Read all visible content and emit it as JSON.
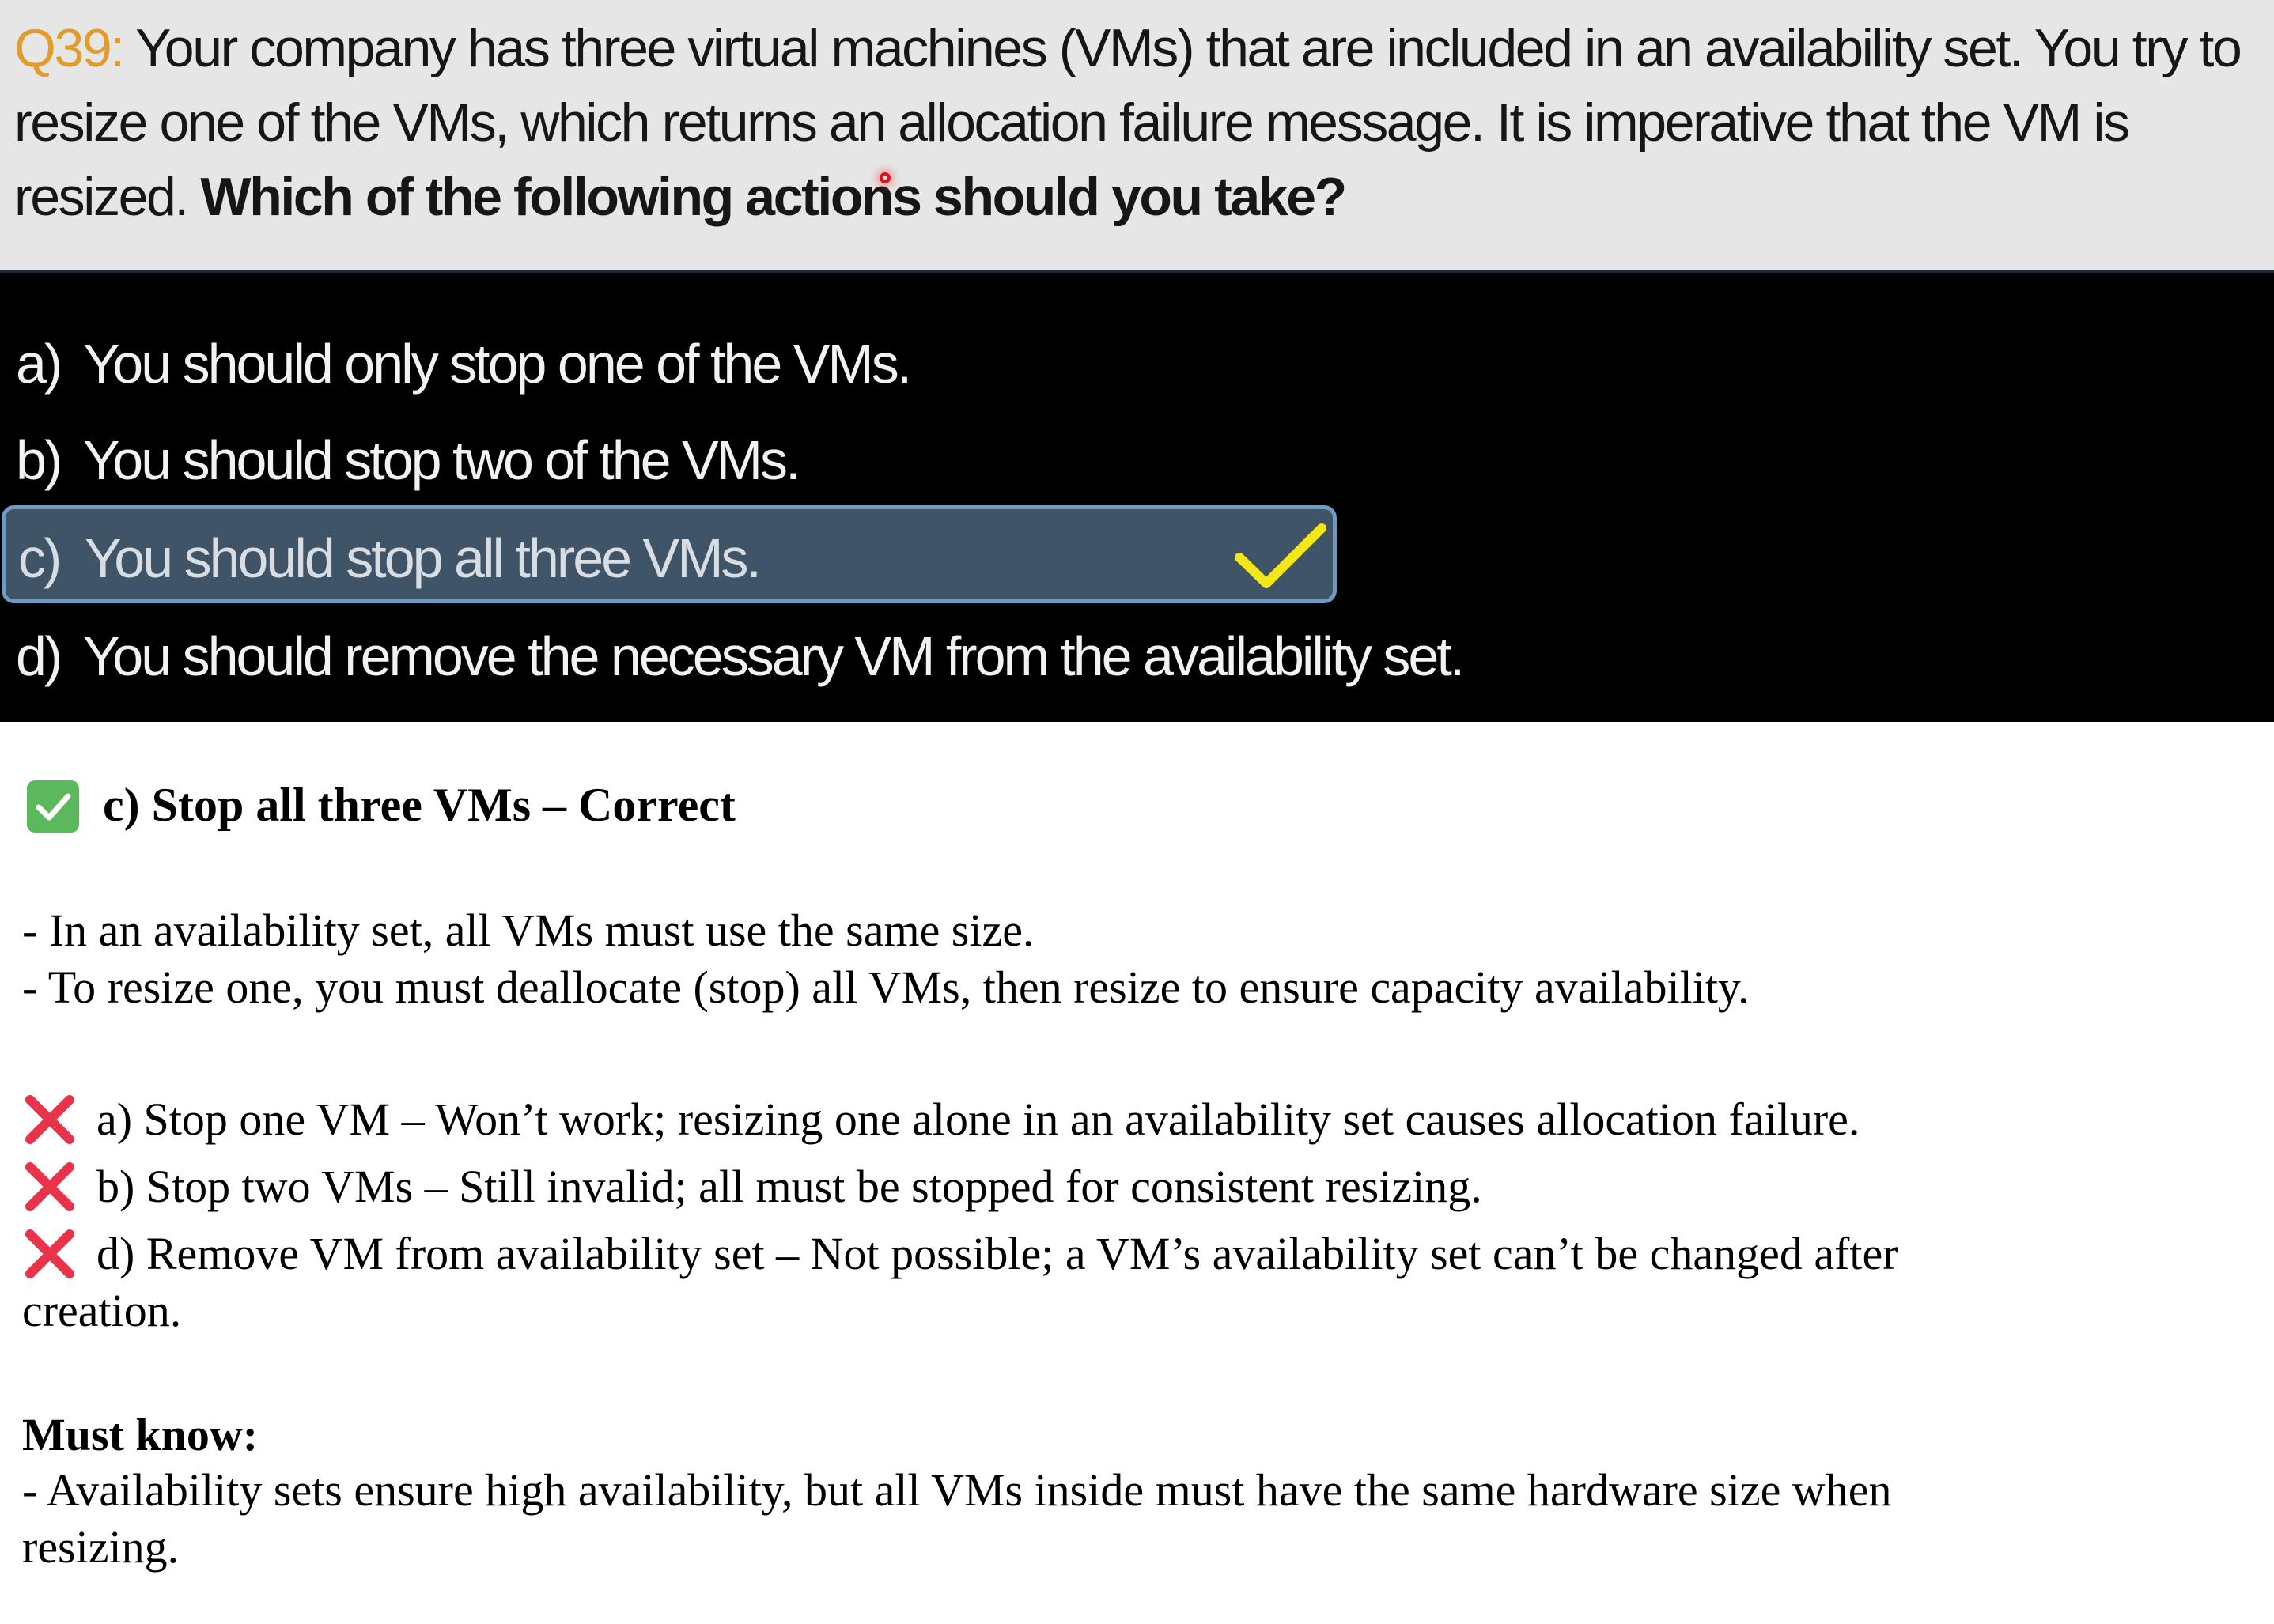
{
  "question": {
    "number": "Q39:",
    "text": " Your company has three virtual machines (VMs) that are included in an availability set. You try to resize one of the VMs, which returns an allocation failure message. It is imperative that the VM is resized. ",
    "prompt": "Which of the following actions should you take?"
  },
  "options": [
    {
      "letter": "a)",
      "text": "You should only stop one of the VMs."
    },
    {
      "letter": "b)",
      "text": "You should stop two of the VMs."
    },
    {
      "letter": "c)",
      "text": "You should stop all three VMs."
    },
    {
      "letter": "d)",
      "text": "You should remove the necessary VM from the availability set."
    }
  ],
  "selected_option": "c",
  "explanation": {
    "heading": "c) Stop all three VMs – Correct",
    "points": [
      "- In an availability set, all VMs must use the same size.",
      "- To resize one, you must deallocate (stop) all VMs, then resize to ensure capacity availability."
    ],
    "wrong": [
      "a) Stop one VM – Won’t work; resizing one alone in an availability set causes allocation failure.",
      "b) Stop two VMs – Still invalid; all must be stopped for consistent resizing.",
      "d) Remove VM from availability set – Not possible; a VM’s availability set can’t be changed after"
    ],
    "wrong_continuation": "creation.",
    "must_know_title": "Must know:",
    "must_know_lines": [
      "- Availability sets ensure high availability, but all VMs inside must have the same hardware size when",
      "resizing."
    ]
  },
  "icons": {
    "correct": "check-mark-button-icon",
    "wrong": "cross-mark-icon",
    "selected": "check-icon"
  },
  "colors": {
    "question_number": "#e39b2a",
    "selected_bg": "#3f5466",
    "selected_border": "#6e9bc4",
    "check_yellow": "#f3e61a",
    "correct_green": "#5cb85c",
    "cross_red": "#e8334a"
  }
}
